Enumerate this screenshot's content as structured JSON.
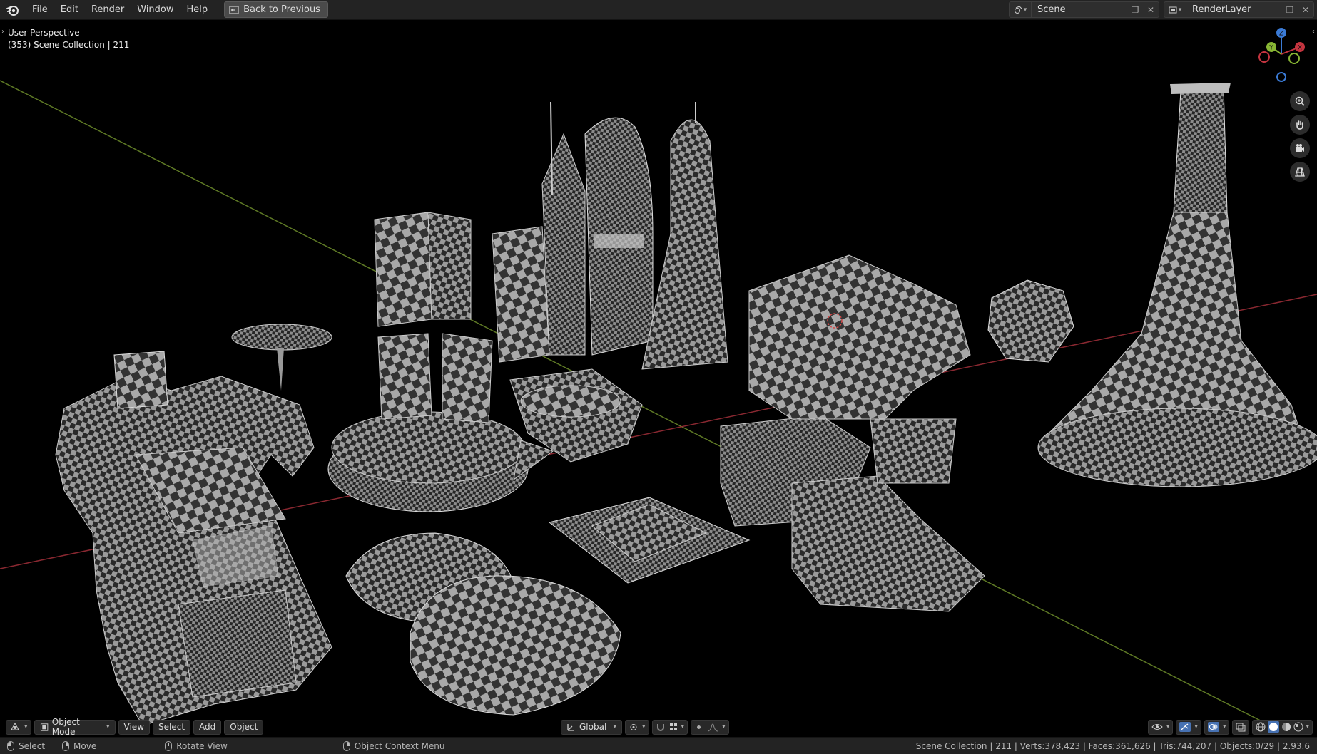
{
  "topbar": {
    "menus": [
      "File",
      "Edit",
      "Render",
      "Window",
      "Help"
    ],
    "back_label": "Back to Previous",
    "scene_name": "Scene",
    "layer_name": "RenderLayer"
  },
  "viewport": {
    "perspective": "User Perspective",
    "collection": "(353) Scene Collection | 211",
    "gizmo": {
      "x": "X",
      "y": "Y",
      "z": "Z"
    }
  },
  "header": {
    "mode": "Object Mode",
    "menus": [
      "View",
      "Select",
      "Add",
      "Object"
    ],
    "orientation": "Global"
  },
  "status": {
    "select": "Select",
    "move": "Move",
    "rotate": "Rotate View",
    "context": "Object Context Menu",
    "stats": "Scene Collection | 211 | Verts:378,423 | Faces:361,626 | Tris:744,207 | Objects:0/29 | 2.93.6"
  },
  "colors": {
    "x_axis": "#c4343f",
    "y_axis": "#88b634",
    "z_axis": "#3b7bd6",
    "bg": "#000000",
    "bar": "#232323"
  }
}
